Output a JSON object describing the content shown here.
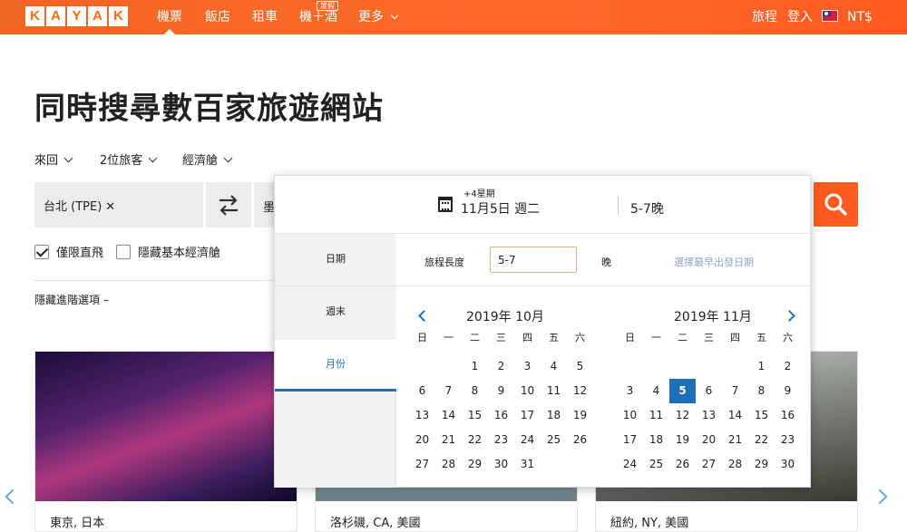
{
  "brand": {
    "logo_letters": [
      "K",
      "A",
      "Y",
      "A",
      "K"
    ],
    "accent": "#ff690f",
    "blue": "#1d6fb8"
  },
  "nav": {
    "items": [
      "機票",
      "飯店",
      "租車",
      "機＋酒",
      "更多"
    ],
    "promo_badge": "度假",
    "right": {
      "trips": "旅程",
      "login": "登入",
      "currency": "NT$"
    }
  },
  "headline": "同時搜尋數百家旅遊網站",
  "filters": {
    "trip_type": "來回",
    "travelers": "2位旅客",
    "cabin": "經濟艙"
  },
  "search": {
    "origin": "台北 (TPE)",
    "origin_remove": "✕",
    "destination_partial": "墨"
  },
  "options": {
    "nonstop": "僅限直飛",
    "hide_basic": "隱藏基本經濟艙",
    "nonstop_checked": true,
    "hide_basic_checked": false
  },
  "advanced": "隱藏進階選項 –",
  "popup": {
    "plus_days": "+4星期",
    "depart_date": "11月5日 週二",
    "nights_header": "5-7晚",
    "tabs": [
      "日期",
      "週末",
      "月份"
    ],
    "active_tab": 2,
    "trip_length_label": "旅程長度",
    "trip_length_value": "5-7",
    "nights_label": "晚",
    "earliest_hint": "選擇最早出發日期",
    "weekdays": [
      "日",
      "一",
      "二",
      "三",
      "四",
      "五",
      "六"
    ],
    "months": [
      {
        "title": "2019年 10月",
        "offset": 2,
        "days": 31
      },
      {
        "title": "2019年 11月",
        "offset": 5,
        "days": 30,
        "selected": 5
      }
    ]
  },
  "cards": [
    {
      "label": "東京, 日本"
    },
    {
      "label": "洛杉磯, CA, 美國"
    },
    {
      "label": "紐約, NY, 美國"
    }
  ]
}
